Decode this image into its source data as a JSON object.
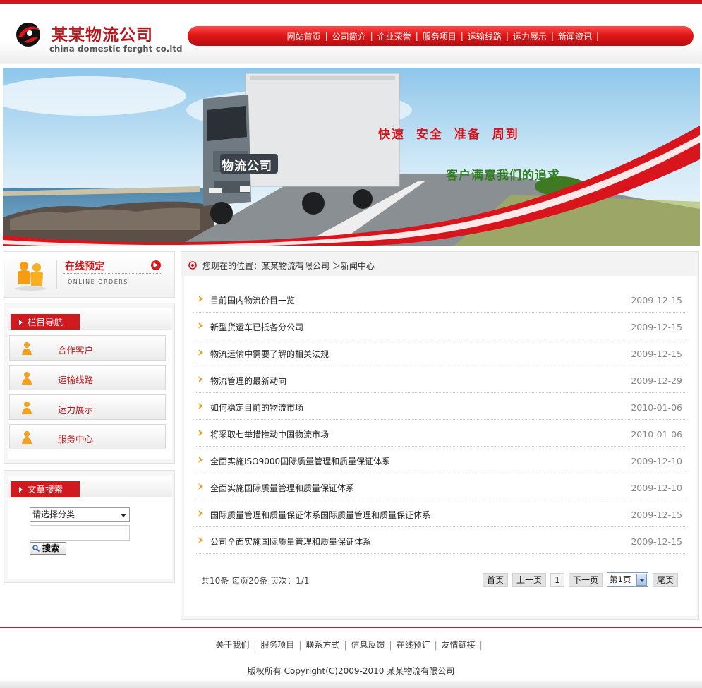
{
  "header": {
    "company_name": "某某物流公司",
    "company_sub": "china  domestic ferght co.ltd",
    "nav": [
      {
        "label": "网站首页"
      },
      {
        "label": "公司简介"
      },
      {
        "label": "企业荣誉"
      },
      {
        "label": "服务项目"
      },
      {
        "label": "运输线路"
      },
      {
        "label": "运力展示"
      },
      {
        "label": "新闻资讯"
      }
    ],
    "nav_separator": "|"
  },
  "banner": {
    "slogan_main": "快速 安全 准备 周到",
    "slogan_sub": "客户满意我们的追求",
    "truck_sign": "物流公司"
  },
  "sidebar": {
    "online": {
      "title": "在线预定",
      "subtitle": "ONLINE ORDERS"
    },
    "nav_title": "栏目导航",
    "nav_items": [
      {
        "label": "合作客户"
      },
      {
        "label": "运输线路"
      },
      {
        "label": "运力展示"
      },
      {
        "label": "服务中心"
      }
    ],
    "search_title": "文章搜索",
    "search_select": "请选择分类",
    "search_input": "",
    "search_button": "搜索"
  },
  "main": {
    "breadcrumb": "您现在的位置：某某物流有限公司 ＞新闻中心",
    "news": [
      {
        "title": "目前国内物流价目一览",
        "date": "2009-12-15"
      },
      {
        "title": "新型货运车已抵各分公司",
        "date": "2009-12-15"
      },
      {
        "title": "物流运输中需要了解的相关法规",
        "date": "2009-12-15"
      },
      {
        "title": "物流管理的最新动向",
        "date": "2009-12-29"
      },
      {
        "title": "如何稳定目前的物流市场",
        "date": "2010-01-06"
      },
      {
        "title": "将采取七举措推动中国物流市场",
        "date": "2010-01-06"
      },
      {
        "title": "全面实施ISO9000国际质量管理和质量保证体系",
        "date": "2009-12-10"
      },
      {
        "title": "全面实施国际质量管理和质量保证体系",
        "date": "2009-12-10"
      },
      {
        "title": "国际质量管理和质量保证体系国际质量管理和质量保证体系",
        "date": "2009-12-15"
      },
      {
        "title": "公司全面实施国际质量管理和质量保证体系",
        "date": "2009-12-15"
      }
    ],
    "pager": {
      "info": "共10条  每页20条  页次：1/1",
      "first": "首页",
      "prev": "上一页",
      "current": "1",
      "next": "下一页",
      "select": "第1页",
      "last": "尾页"
    }
  },
  "footer": {
    "links": [
      {
        "label": "关于我们"
      },
      {
        "label": "服务项目"
      },
      {
        "label": "联系方式"
      },
      {
        "label": "信息反馈"
      },
      {
        "label": "在线预订"
      },
      {
        "label": "友情链接"
      }
    ],
    "separator": "|",
    "copyright": "版权所有  Copyright(C)2009-2010 某某物流有限公司"
  },
  "colors": {
    "brand_red": "#d8151d",
    "date_gray": "#888888",
    "slogan_green": "#2f7d1f"
  }
}
